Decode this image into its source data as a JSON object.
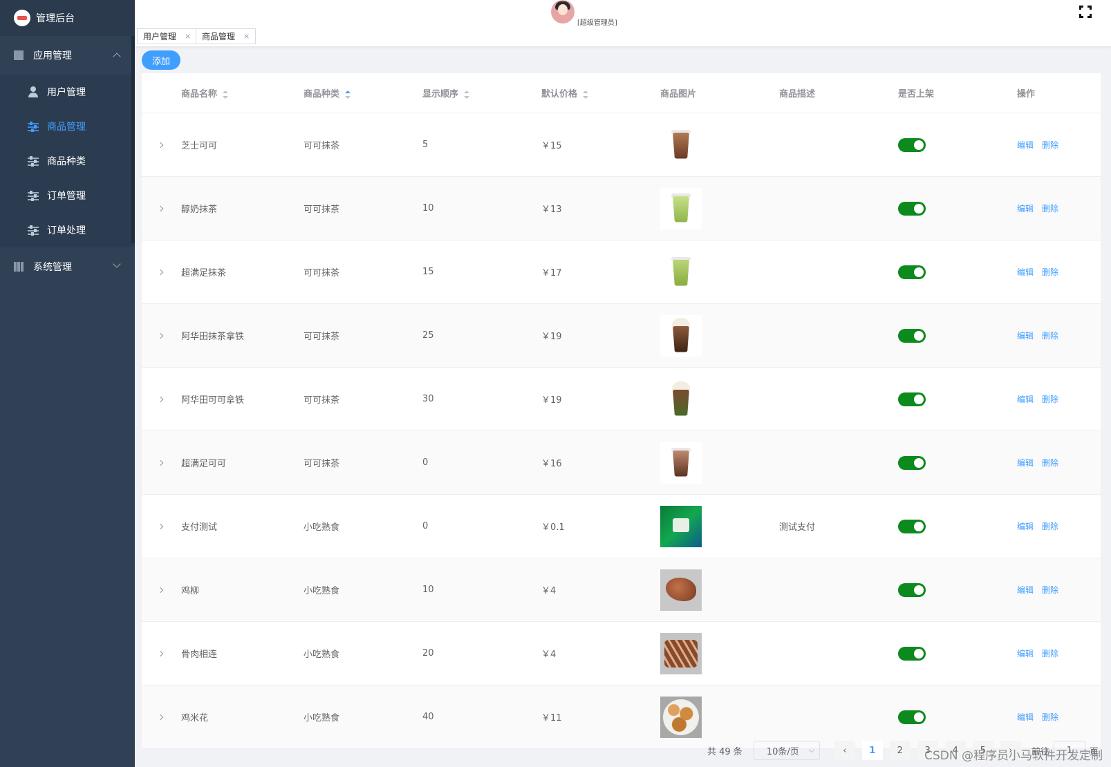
{
  "sidebar": {
    "logo_text": "管理后台",
    "groups": [
      {
        "label": "应用管理",
        "expanded": true
      },
      {
        "label": "系统管理",
        "expanded": false
      }
    ],
    "items": [
      {
        "label": "用户管理",
        "active": false
      },
      {
        "label": "商品管理",
        "active": true
      },
      {
        "label": "商品种类",
        "active": false
      },
      {
        "label": "订单管理",
        "active": false
      },
      {
        "label": "订单处理",
        "active": false
      }
    ]
  },
  "header": {
    "role_text": "[超级管理员]",
    "fullscreen_icon": "fullscreen-icon"
  },
  "tabs": [
    {
      "label": "用户管理",
      "close": "×"
    },
    {
      "label": "商品管理",
      "close": "×"
    }
  ],
  "toolbar": {
    "add_label": "添加"
  },
  "table": {
    "headers": {
      "name": "商品名称",
      "category": "商品种类",
      "order": "显示顺序",
      "price": "默认价格",
      "image": "商品图片",
      "desc": "商品描述",
      "on_shelf": "是否上架",
      "ops": "操作"
    },
    "rows": [
      {
        "name": "芝士可可",
        "category": "可可抹茶",
        "order": "5",
        "price": "￥15",
        "desc": "",
        "img": "cocoa"
      },
      {
        "name": "醇奶抹茶",
        "category": "可可抹茶",
        "order": "10",
        "price": "￥13",
        "desc": "",
        "img": "matcha"
      },
      {
        "name": "超满足抹茶",
        "category": "可可抹茶",
        "order": "15",
        "price": "￥17",
        "desc": "",
        "img": "matcha2"
      },
      {
        "name": "阿华田抹茶拿铁",
        "category": "可可抹茶",
        "order": "25",
        "price": "￥19",
        "desc": "",
        "img": "latte"
      },
      {
        "name": "阿华田可可拿铁",
        "category": "可可抹茶",
        "order": "30",
        "price": "￥19",
        "desc": "",
        "img": "latte2"
      },
      {
        "name": "超满足可可",
        "category": "可可抹茶",
        "order": "0",
        "price": "￥16",
        "desc": "",
        "img": "cocoa2"
      },
      {
        "name": "支付测试",
        "category": "小吃熟食",
        "order": "0",
        "price": "￥0.1",
        "desc": "测试支付",
        "img": "poster"
      },
      {
        "name": "鸡柳",
        "category": "小吃熟食",
        "order": "10",
        "price": "￥4",
        "desc": "",
        "img": "chicken"
      },
      {
        "name": "骨肉相连",
        "category": "小吃熟食",
        "order": "20",
        "price": "￥4",
        "desc": "",
        "img": "skewer"
      },
      {
        "name": "鸡米花",
        "category": "小吃熟食",
        "order": "40",
        "price": "￥11",
        "desc": "",
        "img": "popcorn"
      }
    ],
    "edit_label": "编辑",
    "delete_label": "删除"
  },
  "pagination": {
    "total": "共 49 条",
    "page_size": "10条/页",
    "pages": [
      "1",
      "2",
      "3",
      "4",
      "5"
    ],
    "current": "1",
    "goto_label": "前往",
    "goto_value": "1",
    "page_suffix": "页"
  },
  "watermark": "CSDN @程序员小马软件开发定制",
  "colors": {
    "accent": "#409eff",
    "sidebar": "#304156",
    "toggle_on": "#0c8a1e"
  }
}
